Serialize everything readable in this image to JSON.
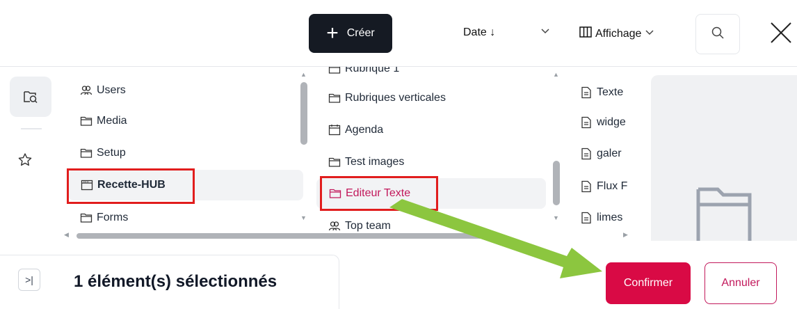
{
  "toolbar": {
    "create_label": "Créer",
    "sort_label": "Date ↓",
    "view_label": "Affichage"
  },
  "columns": {
    "col1": [
      {
        "label": "Users",
        "icon": "users-icon"
      },
      {
        "label": "Media",
        "icon": "folder-icon"
      },
      {
        "label": "Setup",
        "icon": "folder-icon"
      },
      {
        "label": "Recette-HUB",
        "icon": "window-icon",
        "selected": true
      },
      {
        "label": "Forms",
        "icon": "folder-icon"
      }
    ],
    "col2": [
      {
        "label": "Rubrique 1",
        "icon": "folder-icon"
      },
      {
        "label": "Rubriques verticales",
        "icon": "folder-icon"
      },
      {
        "label": "Agenda",
        "icon": "calendar-icon"
      },
      {
        "label": "Test images",
        "icon": "folder-icon"
      },
      {
        "label": "Editeur Texte",
        "icon": "folder-icon",
        "selected": true
      },
      {
        "label": "Top team",
        "icon": "users-icon"
      }
    ],
    "col3": [
      {
        "label": "Texte",
        "icon": "document-icon"
      },
      {
        "label": "widge",
        "icon": "document-icon"
      },
      {
        "label": "galer",
        "icon": "document-icon"
      },
      {
        "label": "Flux F",
        "icon": "document-icon"
      },
      {
        "label": "limes",
        "icon": "document-icon"
      }
    ]
  },
  "footer": {
    "selection_text": "1 élément(s) sélectionnés",
    "confirm_label": "Confirmer",
    "cancel_label": "Annuler"
  },
  "colors": {
    "primary": "#d90a45",
    "create_bg": "#151a23",
    "highlight_box": "#e11d1d",
    "annotation_arrow": "#8cc63f"
  }
}
